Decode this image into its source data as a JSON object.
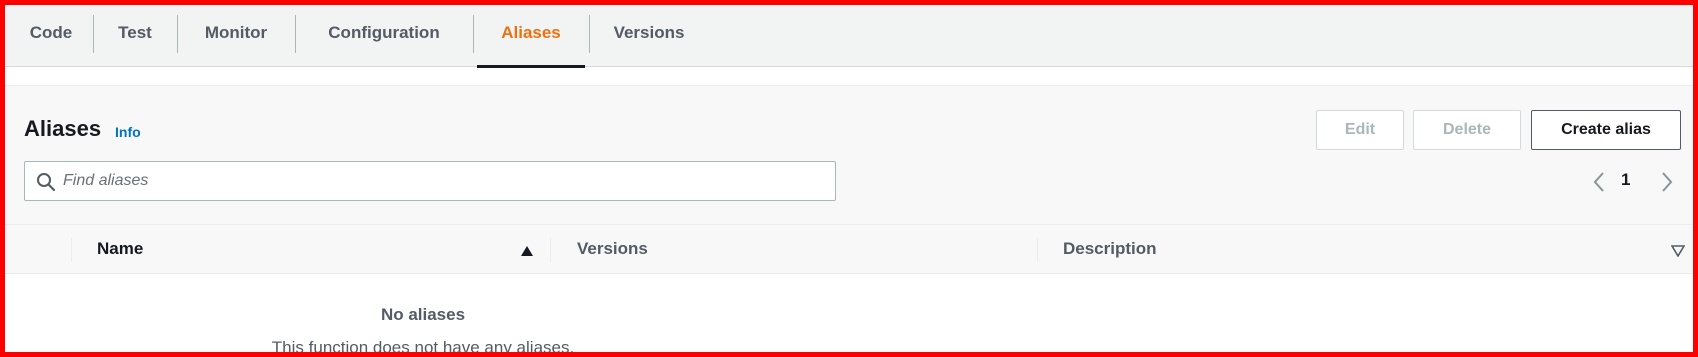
{
  "tabs": [
    {
      "label": "Code",
      "active": false
    },
    {
      "label": "Test",
      "active": false
    },
    {
      "label": "Monitor",
      "active": false
    },
    {
      "label": "Configuration",
      "active": false
    },
    {
      "label": "Aliases",
      "active": true
    },
    {
      "label": "Versions",
      "active": false
    }
  ],
  "panel": {
    "title": "Aliases",
    "info_label": "Info",
    "buttons": {
      "edit": "Edit",
      "delete": "Delete",
      "create": "Create alias"
    },
    "search": {
      "placeholder": "Find aliases",
      "value": ""
    },
    "pagination": {
      "current_page": "1"
    }
  },
  "table": {
    "columns": [
      "Name",
      "Versions",
      "Description"
    ],
    "sorted_column": "Name",
    "sort_direction": "ascending",
    "empty_title": "No aliases",
    "empty_description": "This function does not have any aliases."
  },
  "colors": {
    "active_tab": "#ec7211",
    "link": "#0073bb",
    "frame_border": "#ff0000",
    "text": "#16191f",
    "muted_text": "#545b64"
  },
  "icons": {
    "search": "search-icon",
    "prev_page": "chevron-left-icon",
    "next_page": "chevron-right-icon",
    "sort": "sort-up-icon",
    "settings": "caret-down-icon"
  }
}
